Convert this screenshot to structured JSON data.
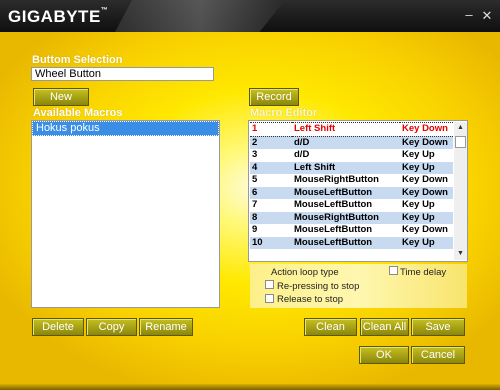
{
  "window": {
    "logo": "GIGABYTE",
    "trademark": "™",
    "minimize_icon": "–",
    "close_icon": "✕"
  },
  "button_selection": {
    "label": "Buttom Selection",
    "value": "Wheel Button"
  },
  "new_label": "New",
  "record_label": "Record",
  "available_macros": {
    "label": "Available Macros",
    "items": [
      "Hokus pokus"
    ],
    "selected_index": 0
  },
  "macro_editor": {
    "label": "Macro Editor",
    "rows": [
      {
        "num": "1",
        "key": "Left Shift",
        "action": "Key Down"
      },
      {
        "num": "2",
        "key": "d/D",
        "action": "Key Down"
      },
      {
        "num": "3",
        "key": "d/D",
        "action": "Key Up"
      },
      {
        "num": "4",
        "key": "Left Shift",
        "action": "Key Up"
      },
      {
        "num": "5",
        "key": "MouseRightButton",
        "action": "Key Down"
      },
      {
        "num": "6",
        "key": "MouseLeftButton",
        "action": "Key Down"
      },
      {
        "num": "7",
        "key": "MouseLeftButton",
        "action": "Key Up"
      },
      {
        "num": "8",
        "key": "MouseRightButton",
        "action": "Key Up"
      },
      {
        "num": "9",
        "key": "MouseLeftButton",
        "action": "Key Down"
      },
      {
        "num": "10",
        "key": "MouseLeftButton",
        "action": "Key Up"
      }
    ],
    "selected_index": 0
  },
  "options": {
    "action_loop_type": "Action loop type",
    "time_delay": "Time delay",
    "re_pressing": "Re-pressing to stop",
    "release": "Release to stop"
  },
  "buttons": {
    "delete": "Delete",
    "copy": "Copy",
    "rename": "Rename",
    "clean": "Clean",
    "clean_all": "Clean All",
    "save": "Save",
    "ok": "OK",
    "cancel": "Cancel"
  },
  "colors": {
    "accent_yellow": "#ffe800",
    "button_olive": "#a8a318",
    "selection_blue": "#3a8ee6",
    "row_alt": "#c8daf0",
    "selected_row_text": "#e60000"
  }
}
